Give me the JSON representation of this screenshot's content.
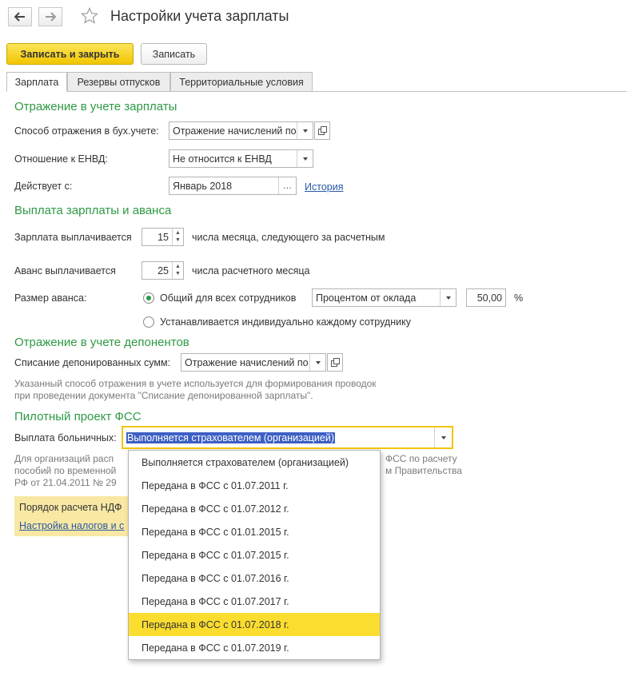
{
  "window": {
    "title": "Настройки учета зарплаты"
  },
  "toolbar": {
    "save_close_label": "Записать и закрыть",
    "save_label": "Записать"
  },
  "tabs": [
    {
      "label": "Зарплата",
      "active": true
    },
    {
      "label": "Резервы отпусков",
      "active": false
    },
    {
      "label": "Территориальные условия",
      "active": false
    }
  ],
  "salary_reflection": {
    "heading": "Отражение в учете зарплаты",
    "method_label": "Способ отражения в бух.учете:",
    "method_value": "Отражение начислений по",
    "envd_label": "Отношение к ЕНВД:",
    "envd_value": "Не относится к ЕНВД",
    "effective_label": "Действует с:",
    "effective_value": "Январь 2018",
    "history_link": "История"
  },
  "payment": {
    "heading": "Выплата зарплаты и аванса",
    "salary_label": "Зарплата выплачивается",
    "salary_day": "15",
    "salary_suffix": "числа месяца, следующего за расчетным",
    "advance_label": "Аванс выплачивается",
    "advance_day": "25",
    "advance_suffix": "числа расчетного месяца",
    "advance_size_label": "Размер аванса:",
    "radio_common": "Общий для всех сотрудников",
    "advance_method": "Процентом от оклада",
    "advance_percent": "50,00",
    "percent_sign": "%",
    "radio_individual": "Устанавливается индивидуально каждому сотруднику"
  },
  "deposits": {
    "heading": "Отражение в учете депонентов",
    "writeoff_label": "Списание депонированных сумм:",
    "writeoff_value": "Отражение начислений по",
    "note_line1": "Указанный способ отражения в учете используется для формирования проводок",
    "note_line2": "при проведении документа \"Списание депонированной зарплаты\"."
  },
  "fss": {
    "heading": "Пилотный проект ФСС",
    "sick_pay_label": "Выплата больничных:",
    "sick_pay_value": "Выполняется страхователем (организацией)",
    "note_left_1": "Для организаций расп",
    "note_left_2": "пособий по временной",
    "note_left_3": "РФ от 21.04.2011 № 29",
    "note_right_1": "ФСС по расчету",
    "note_right_2": "м Правительства"
  },
  "ndfl": {
    "text": "Порядок расчета НДФ",
    "link": "Настройка налогов и с"
  },
  "dropdown_options": [
    "Выполняется страхователем (организацией)",
    "Передана в ФСС с 01.07.2011 г.",
    "Передана в ФСС с 01.07.2012 г.",
    "Передана в ФСС с 01.01.2015 г.",
    "Передана в ФСС с 01.07.2015 г.",
    "Передана в ФСС с 01.07.2016 г.",
    "Передана в ФСС с 01.07.2017 г.",
    "Передана в ФСС с 01.07.2018 г.",
    "Передана в ФСС с 01.07.2019 г."
  ],
  "highlighted_option_index": 7,
  "colors": {
    "accent_green": "#2e9a44",
    "primary_yellow": "#f2c500",
    "link_blue": "#2a58a5",
    "highlight": "#fbdd2f"
  }
}
